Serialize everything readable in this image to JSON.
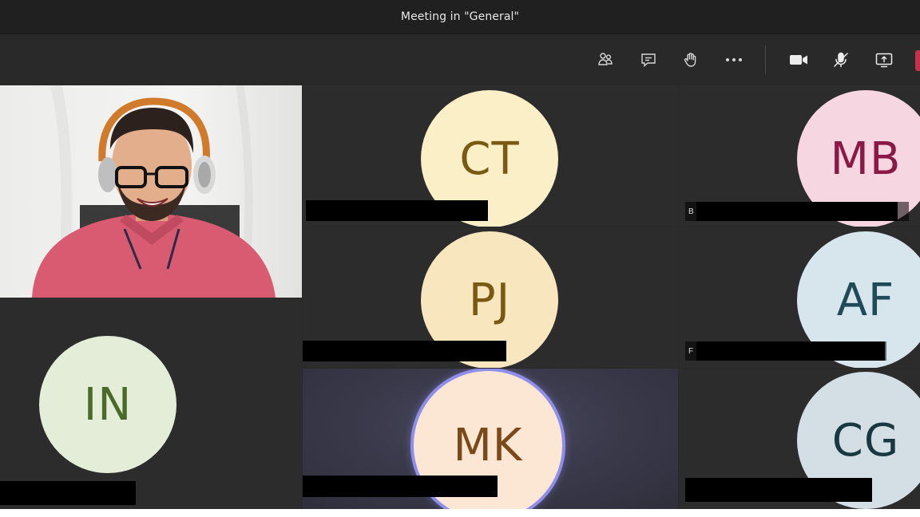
{
  "window": {
    "title": "Meeting in \"General\""
  },
  "toolbar": {
    "buttons": [
      {
        "icon": "people-icon"
      },
      {
        "icon": "chat-icon"
      },
      {
        "icon": "raise-hand-icon"
      },
      {
        "icon": "more-options-icon"
      },
      {
        "icon": "camera-icon"
      },
      {
        "icon": "mic-muted-icon"
      },
      {
        "icon": "share-screen-icon"
      }
    ]
  },
  "participants": [
    {
      "initials": "CT",
      "bg": "#fbefc8",
      "fg": "#7a5a12"
    },
    {
      "initials": "MB",
      "bg": "#f6d6e1",
      "fg": "#8a1a45"
    },
    {
      "initials": "PJ",
      "bg": "#f8e6bf",
      "fg": "#7a5a12"
    },
    {
      "initials": "AF",
      "bg": "#d7e5ec",
      "fg": "#1f4a58"
    },
    {
      "initials": "IN",
      "bg": "#e4edd8",
      "fg": "#4a6a2a"
    },
    {
      "initials": "MK",
      "bg": "#fce6d4",
      "fg": "#7a4a1a"
    },
    {
      "initials": "CG",
      "bg": "#d3dfe4",
      "fg": "#17393f"
    }
  ],
  "name_plates": {
    "mb_prefix": "B",
    "af_prefix": "F"
  },
  "colors": {
    "active_speaker_ring": "#8f8fea",
    "hangup": "#c4314b"
  }
}
